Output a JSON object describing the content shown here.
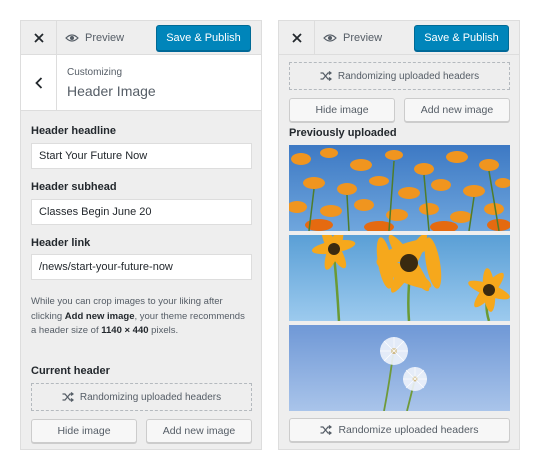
{
  "toolbar": {
    "close_icon": "close-icon",
    "preview_label": "Preview",
    "save_label": "Save & Publish"
  },
  "section": {
    "breadcrumb": "Customizing",
    "title": "Header Image"
  },
  "form": {
    "headline_label": "Header headline",
    "headline_value": "Start Your Future Now",
    "subhead_label": "Header subhead",
    "subhead_value": "Classes Begin June 20",
    "link_label": "Header link",
    "link_value": "/news/start-your-future-now",
    "desc_1": "While you can crop images to your liking after clicking ",
    "desc_strong_1": "Add new image",
    "desc_2": ", your theme recommends a header size of ",
    "desc_strong_2": "1140 × 440",
    "desc_3": " pixels."
  },
  "current_header": {
    "label": "Current header",
    "randomizing_text": "Randomizing uploaded headers",
    "hide_label": "Hide image",
    "add_label": "Add new image"
  },
  "uploads": {
    "randomizing_text": "Randomizing uploaded headers",
    "hide_label": "Hide image",
    "add_label": "Add new image",
    "previously_uploaded_label": "Previously uploaded",
    "randomize_button_label": "Randomize uploaded headers"
  },
  "colors": {
    "accent": "#0085ba",
    "panel_bg": "#eeeeee"
  }
}
